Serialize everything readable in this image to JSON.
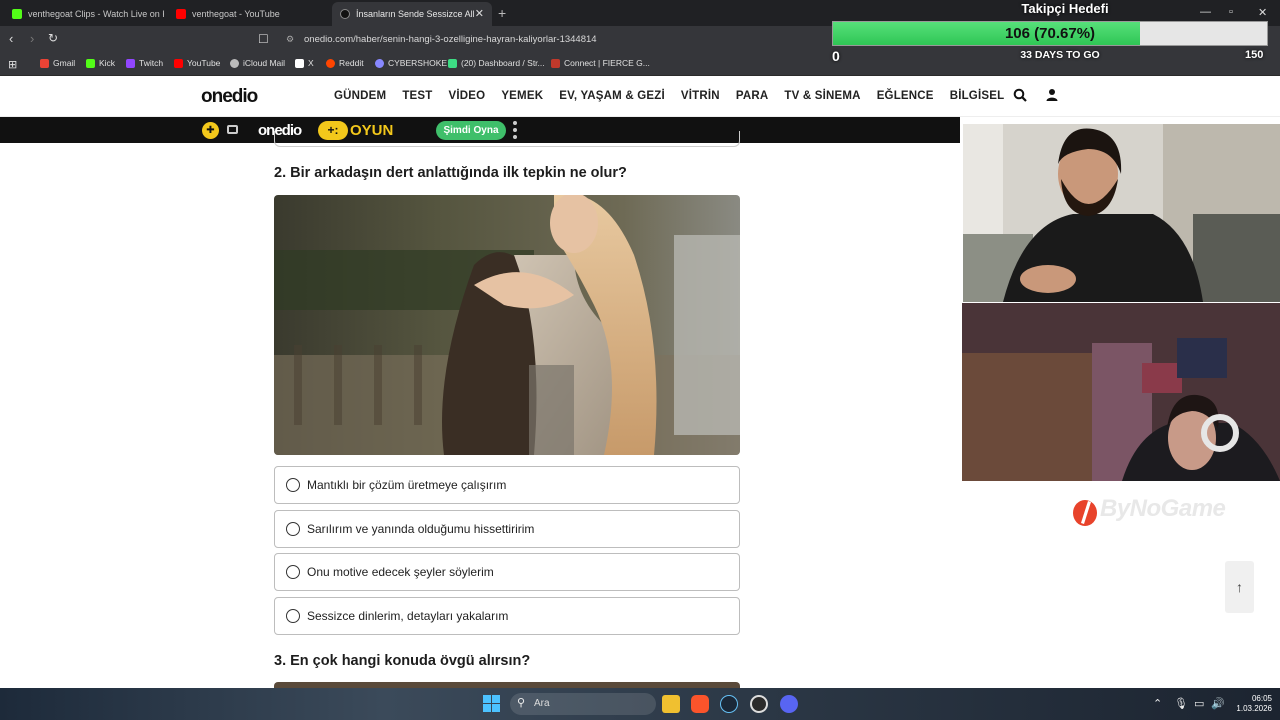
{
  "browser": {
    "tabs": [
      {
        "title": "venthegoat Clips - Watch Live on Kick",
        "active": false,
        "favicon_color": "#53fc18"
      },
      {
        "title": "venthegoat - YouTube",
        "active": false,
        "favicon_color": "#ff0000"
      },
      {
        "title": "İnsanların Sende Sessizce Alkışla",
        "active": true,
        "favicon_color": "#111111"
      }
    ],
    "url": "onedio.com/haber/senin-hangi-3-ozelligine-hayran-kaliyorlar-1344814",
    "bookmarks": [
      {
        "label": "Gmail",
        "color": "#ea4335"
      },
      {
        "label": "Kick",
        "color": "#53fc18"
      },
      {
        "label": "Twitch",
        "color": "#9146ff"
      },
      {
        "label": "YouTube",
        "color": "#ff0000"
      },
      {
        "label": "iCloud Mail",
        "color": "#bbbbbb"
      },
      {
        "label": "X",
        "color": "#ffffff"
      },
      {
        "label": "Reddit",
        "color": "#ff4500"
      },
      {
        "label": "CYBERSHOKE",
        "color": "#8888ff"
      },
      {
        "label": "(20) Dashboard / Str...",
        "color": "#3ddc84"
      },
      {
        "label": "Connect | FIERCE G...",
        "color": "#c0392b"
      }
    ]
  },
  "goal": {
    "title": "Takipçi Hedefi",
    "value_text": "106 (70.67%)",
    "progress_fraction": 0.7067,
    "min": "0",
    "days_text": "33 DAYS TO GO",
    "max": "150"
  },
  "site": {
    "logo": "onedio",
    "menu": [
      "GÜNDEM",
      "TEST",
      "VİDEO",
      "YEMEK",
      "EV, YAŞAM & GEZİ",
      "VİTRİN",
      "PARA",
      "TV & SİNEMA",
      "EĞLENCE",
      "BİLGİSEL"
    ],
    "promo": {
      "logo": "onedio",
      "plus": "+:",
      "oyun": "OYUN",
      "button": "Şimdi Oyna"
    }
  },
  "quiz": {
    "question2": "2. Bir arkadaşın dert anlattığında ilk tepkin ne olur?",
    "options": [
      "Mantıklı bir çözüm üretmeye çalışırım",
      "Sarılırım ve yanında olduğumu hissettiririm",
      "Onu motive edecek şeyler söylerim",
      "Sessizce dinlerim, detayları yakalarım"
    ],
    "question3": "3. En çok hangi konuda övgü alırsın?"
  },
  "overlay": {
    "watermark": "ByNoGame"
  },
  "taskbar": {
    "search_placeholder": "Ara",
    "time": "06:05",
    "date": "1.03.2026"
  }
}
